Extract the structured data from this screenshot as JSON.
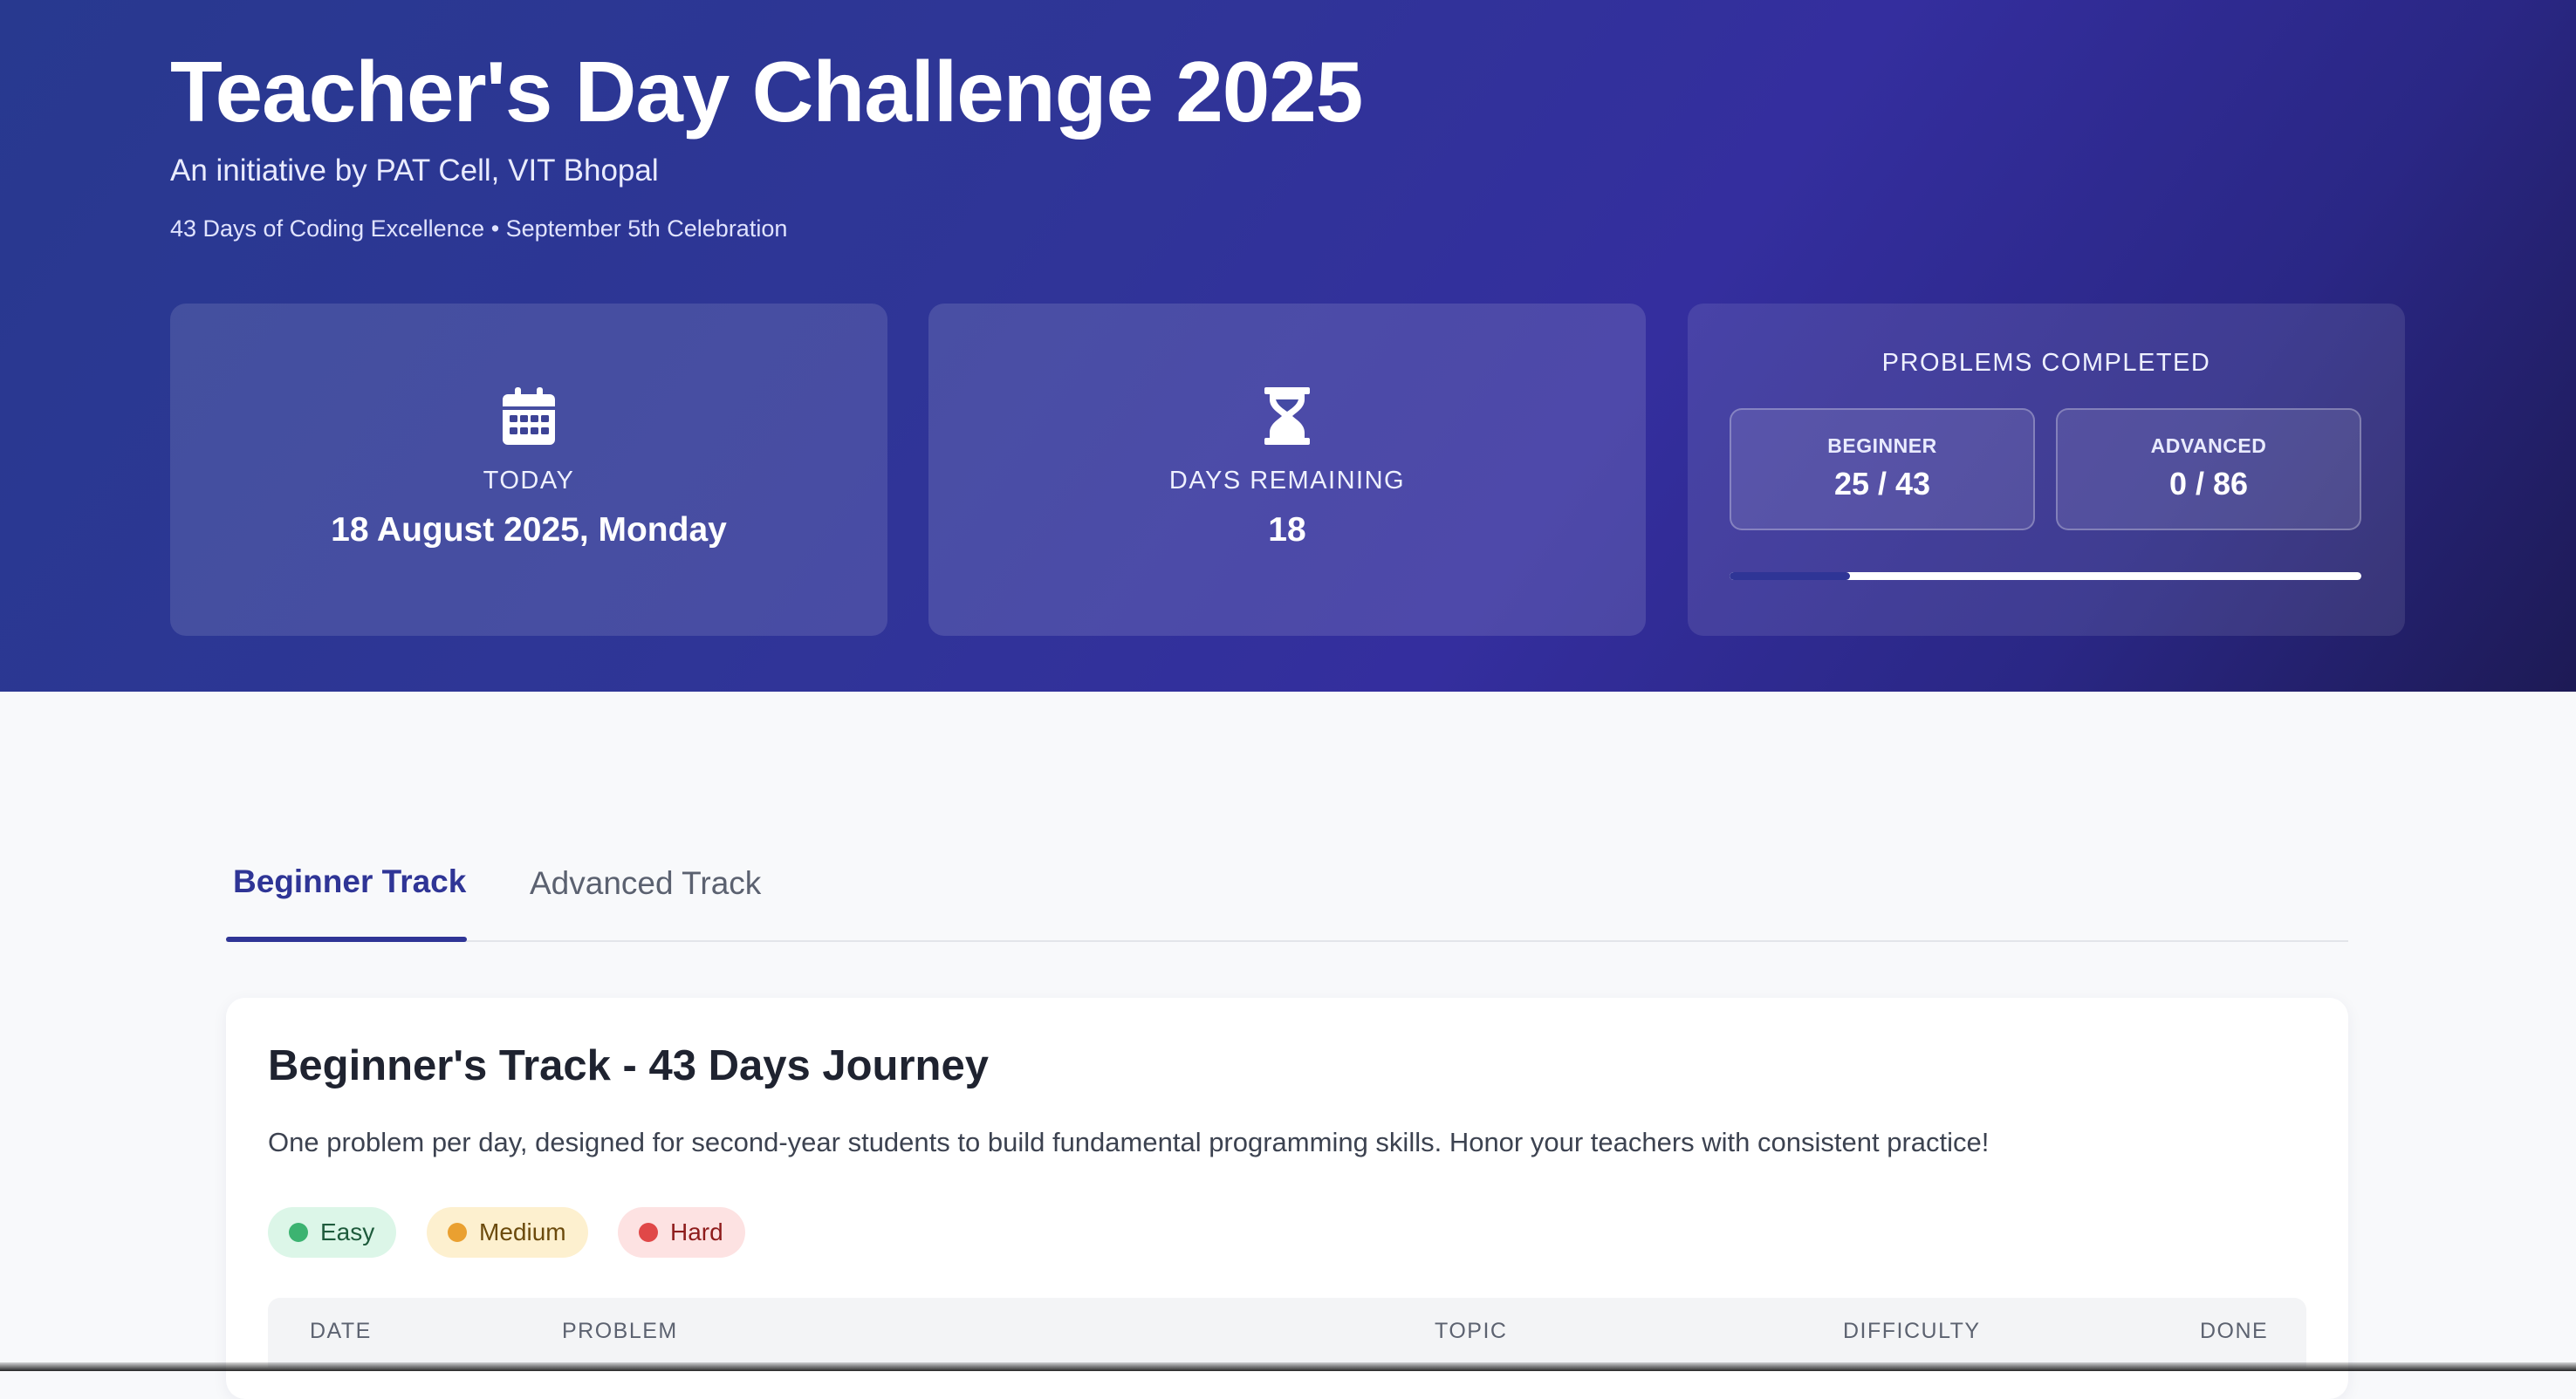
{
  "hero": {
    "title": "Teacher's Day Challenge 2025",
    "subtitle": "An initiative by PAT Cell, VIT Bhopal",
    "tagline": "43 Days of Coding Excellence • September 5th Celebration"
  },
  "stats": {
    "today": {
      "icon": "calendar-icon",
      "label": "TODAY",
      "value": "18 August 2025, Monday"
    },
    "days_remaining": {
      "icon": "hourglass-icon",
      "label": "DAYS REMAINING",
      "value": "18"
    },
    "problems": {
      "label": "PROBLEMS COMPLETED",
      "beginner": {
        "label": "BEGINNER",
        "value": "25 / 43"
      },
      "advanced": {
        "label": "ADVANCED",
        "value": "0 / 86"
      },
      "progress_fraction": 0.19
    }
  },
  "tabs": [
    {
      "label": "Beginner Track",
      "active": true
    },
    {
      "label": "Advanced Track",
      "active": false
    }
  ],
  "track": {
    "title": "Beginner's Track - 43 Days Journey",
    "description": "One problem per day, designed for second-year students to build fundamental programming skills. Honor your teachers with consistent practice!",
    "legend": [
      {
        "label": "Easy",
        "color": "#3cb371"
      },
      {
        "label": "Medium",
        "color": "#eaa030"
      },
      {
        "label": "Hard",
        "color": "#e04848"
      }
    ],
    "columns": [
      "DATE",
      "PROBLEM",
      "TOPIC",
      "DIFFICULTY",
      "DONE"
    ]
  },
  "colors": {
    "accent": "#2f3596",
    "hero_gradient_start": "#28398f",
    "hero_gradient_end": "#1d1a55"
  }
}
